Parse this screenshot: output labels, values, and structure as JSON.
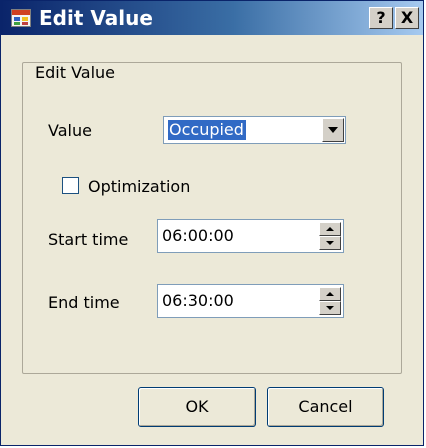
{
  "window": {
    "title": "Edit Value",
    "help_label": "?",
    "close_label": "X"
  },
  "group": {
    "title": "Edit Value"
  },
  "form": {
    "value_label": "Value",
    "value_selected": "Occupied",
    "optimization_label": "Optimization",
    "optimization_checked": false,
    "start_time_label": "Start time",
    "start_time_value": "06:00:00",
    "end_time_label": "End time",
    "end_time_value": "06:30:00"
  },
  "buttons": {
    "ok_label": "OK",
    "cancel_label": "Cancel"
  },
  "icons": {
    "app": "app-window-icon",
    "dropdown": "chevron-down-icon",
    "spin_up": "spin-up-icon",
    "spin_down": "spin-down-icon"
  },
  "colors": {
    "titlebar_start": "#0a246a",
    "titlebar_end": "#a6caf0",
    "selection": "#316ac5",
    "dialog_bg": "#ece9d8"
  }
}
